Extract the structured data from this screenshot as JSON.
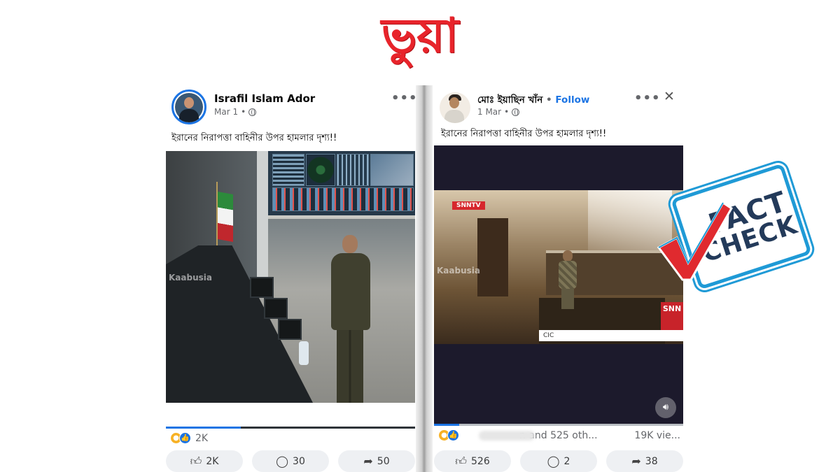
{
  "header": {
    "label": "ভুয়া"
  },
  "posts": [
    {
      "author": "Israfil Islam Ador",
      "date": "Mar 1",
      "caption": "ইরানের নিরাপত্তা বাহিনীর উপর হামলার দৃশ্য!!",
      "video": {
        "watermark": "Kaabusia",
        "progress": 0.3
      },
      "reaction_count": "2K",
      "actions": {
        "like": "2K",
        "comment": "30",
        "share": "50"
      }
    },
    {
      "author": "মোঃ ইয়াছিন খাঁন",
      "follow_label": "Follow",
      "date": "1 Mar",
      "caption": "ইরানের নিরাপত্তা বাহিনীর উপর হামলার দৃশ্য!!",
      "video": {
        "watermark": "Kaabusia",
        "badge": "SNNTV",
        "logo": "SNN",
        "ticker": "CIC",
        "progress": 0.1
      },
      "reaction_summary": "n and 525 oth...",
      "views": "19K vie...",
      "actions": {
        "like": "526",
        "comment": "2",
        "share": "38"
      }
    }
  ],
  "stamp": {
    "line1": "FACT",
    "line2": "CHECK"
  },
  "colors": {
    "fake_label": "#e8242b",
    "facebook_blue": "#1b74e4",
    "stamp_border": "#1f9ad6",
    "stamp_text": "#233a5a",
    "check_red": "#e02a2f"
  }
}
